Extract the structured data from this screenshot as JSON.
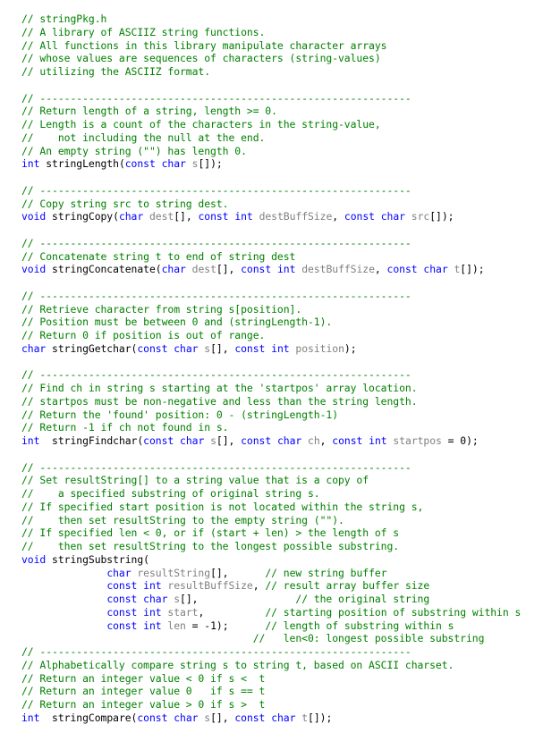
{
  "editor": {
    "file": "stringPkg.h",
    "colors": {
      "comment": "#008000",
      "keyword": "#0000ff",
      "parameter": "#808080",
      "identifier": "#000000",
      "background": "#ffffff"
    },
    "lines": [
      [
        [
          "cm",
          "// stringPkg.h"
        ]
      ],
      [
        [
          "cm",
          "// A library of ASCIIZ string functions."
        ]
      ],
      [
        [
          "cm",
          "// All functions in this library manipulate character arrays"
        ]
      ],
      [
        [
          "cm",
          "// whose values are sequences of characters (string-values)"
        ]
      ],
      [
        [
          "cm",
          "// utilizing the ASCIIZ format."
        ]
      ],
      [],
      [
        [
          "cm",
          "// -------------------------------------------------------------"
        ]
      ],
      [
        [
          "cm",
          "// Return length of a string, length >= 0."
        ]
      ],
      [
        [
          "cm",
          "// Length is a count of the characters in the string-value,"
        ]
      ],
      [
        [
          "cm",
          "//    not including the null at the end."
        ]
      ],
      [
        [
          "cm",
          "// An empty string (\"\") has length 0."
        ]
      ],
      [
        [
          "kw",
          "int"
        ],
        [
          "id",
          " stringLength("
        ],
        [
          "kw",
          "const"
        ],
        [
          "id",
          " "
        ],
        [
          "kw",
          "char"
        ],
        [
          "id",
          " "
        ],
        [
          "pm",
          "s"
        ],
        [
          "id",
          "[]);"
        ]
      ],
      [],
      [
        [
          "cm",
          "// -------------------------------------------------------------"
        ]
      ],
      [
        [
          "cm",
          "// Copy string src to string dest."
        ]
      ],
      [
        [
          "kw",
          "void"
        ],
        [
          "id",
          " stringCopy("
        ],
        [
          "kw",
          "char"
        ],
        [
          "id",
          " "
        ],
        [
          "pm",
          "dest"
        ],
        [
          "id",
          "[], "
        ],
        [
          "kw",
          "const"
        ],
        [
          "id",
          " "
        ],
        [
          "kw",
          "int"
        ],
        [
          "id",
          " "
        ],
        [
          "pm",
          "destBuffSize"
        ],
        [
          "id",
          ", "
        ],
        [
          "kw",
          "const"
        ],
        [
          "id",
          " "
        ],
        [
          "kw",
          "char"
        ],
        [
          "id",
          " "
        ],
        [
          "pm",
          "src"
        ],
        [
          "id",
          "[]);"
        ]
      ],
      [],
      [
        [
          "cm",
          "// -------------------------------------------------------------"
        ]
      ],
      [
        [
          "cm",
          "// Concatenate string t to end of string dest"
        ]
      ],
      [
        [
          "kw",
          "void"
        ],
        [
          "id",
          " stringConcatenate("
        ],
        [
          "kw",
          "char"
        ],
        [
          "id",
          " "
        ],
        [
          "pm",
          "dest"
        ],
        [
          "id",
          "[], "
        ],
        [
          "kw",
          "const"
        ],
        [
          "id",
          " "
        ],
        [
          "kw",
          "int"
        ],
        [
          "id",
          " "
        ],
        [
          "pm",
          "destBuffSize"
        ],
        [
          "id",
          ", "
        ],
        [
          "kw",
          "const"
        ],
        [
          "id",
          " "
        ],
        [
          "kw",
          "char"
        ],
        [
          "id",
          " "
        ],
        [
          "pm",
          "t"
        ],
        [
          "id",
          "[]);"
        ]
      ],
      [],
      [
        [
          "cm",
          "// -------------------------------------------------------------"
        ]
      ],
      [
        [
          "cm",
          "// Retrieve character from string s[position]."
        ]
      ],
      [
        [
          "cm",
          "// Position must be between 0 and (stringLength-1)."
        ]
      ],
      [
        [
          "cm",
          "// Return 0 if position is out of range."
        ]
      ],
      [
        [
          "kw",
          "char"
        ],
        [
          "id",
          " stringGetchar("
        ],
        [
          "kw",
          "const"
        ],
        [
          "id",
          " "
        ],
        [
          "kw",
          "char"
        ],
        [
          "id",
          " "
        ],
        [
          "pm",
          "s"
        ],
        [
          "id",
          "[], "
        ],
        [
          "kw",
          "const"
        ],
        [
          "id",
          " "
        ],
        [
          "kw",
          "int"
        ],
        [
          "id",
          " "
        ],
        [
          "pm",
          "position"
        ],
        [
          "id",
          ");"
        ]
      ],
      [],
      [
        [
          "cm",
          "// -------------------------------------------------------------"
        ]
      ],
      [
        [
          "cm",
          "// Find ch in string s starting at the 'startpos' array location."
        ]
      ],
      [
        [
          "cm",
          "// startpos must be non-negative and less than the string length."
        ]
      ],
      [
        [
          "cm",
          "// Return the 'found' position: 0 - (stringLength-1)"
        ]
      ],
      [
        [
          "cm",
          "// Return -1 if ch not found in s."
        ]
      ],
      [
        [
          "kw",
          "int"
        ],
        [
          "id",
          "  stringFindchar("
        ],
        [
          "kw",
          "const"
        ],
        [
          "id",
          " "
        ],
        [
          "kw",
          "char"
        ],
        [
          "id",
          " "
        ],
        [
          "pm",
          "s"
        ],
        [
          "id",
          "[], "
        ],
        [
          "kw",
          "const"
        ],
        [
          "id",
          " "
        ],
        [
          "kw",
          "char"
        ],
        [
          "id",
          " "
        ],
        [
          "pm",
          "ch"
        ],
        [
          "id",
          ", "
        ],
        [
          "kw",
          "const"
        ],
        [
          "id",
          " "
        ],
        [
          "kw",
          "int"
        ],
        [
          "id",
          " "
        ],
        [
          "pm",
          "startpos"
        ],
        [
          "id",
          " = 0);"
        ]
      ],
      [],
      [
        [
          "cm",
          "// -------------------------------------------------------------"
        ]
      ],
      [
        [
          "cm",
          "// Set resultString[] to a string value that is a copy of"
        ]
      ],
      [
        [
          "cm",
          "//    a specified substring of original string s."
        ]
      ],
      [
        [
          "cm",
          "// If specified start position is not located within the string s,"
        ]
      ],
      [
        [
          "cm",
          "//    then set resultString to the empty string (\"\")."
        ]
      ],
      [
        [
          "cm",
          "// If specified len < 0, or if (start + len) > the length of s"
        ]
      ],
      [
        [
          "cm",
          "//    then set resultString to the longest possible substring."
        ]
      ],
      [
        [
          "kw",
          "void"
        ],
        [
          "id",
          " stringSubstring("
        ]
      ],
      [
        [
          "id",
          "              "
        ],
        [
          "kw",
          "char"
        ],
        [
          "id",
          " "
        ],
        [
          "pm",
          "resultString"
        ],
        [
          "id",
          "[],      "
        ],
        [
          "cm",
          "// new string buffer"
        ]
      ],
      [
        [
          "id",
          "              "
        ],
        [
          "kw",
          "const"
        ],
        [
          "id",
          " "
        ],
        [
          "kw",
          "int"
        ],
        [
          "id",
          " "
        ],
        [
          "pm",
          "resultBuffSize"
        ],
        [
          "id",
          ", "
        ],
        [
          "cm",
          "// result array buffer size"
        ]
      ],
      [
        [
          "id",
          "              "
        ],
        [
          "kw",
          "const"
        ],
        [
          "id",
          " "
        ],
        [
          "kw",
          "char"
        ],
        [
          "id",
          " "
        ],
        [
          "pm",
          "s"
        ],
        [
          "id",
          "[],                "
        ],
        [
          "cm",
          "// the original string"
        ]
      ],
      [
        [
          "id",
          "              "
        ],
        [
          "kw",
          "const"
        ],
        [
          "id",
          " "
        ],
        [
          "kw",
          "int"
        ],
        [
          "id",
          " "
        ],
        [
          "pm",
          "start"
        ],
        [
          "id",
          ",          "
        ],
        [
          "cm",
          "// starting position of substring within s"
        ]
      ],
      [
        [
          "id",
          "              "
        ],
        [
          "kw",
          "const"
        ],
        [
          "id",
          " "
        ],
        [
          "kw",
          "int"
        ],
        [
          "id",
          " "
        ],
        [
          "pm",
          "len"
        ],
        [
          "id",
          " = -1);      "
        ],
        [
          "cm",
          "// length of substring within s"
        ]
      ],
      [
        [
          "id",
          "                                      "
        ],
        [
          "cm",
          "//   len<0: longest possible substring"
        ]
      ],
      [
        [
          "cm",
          "// -------------------------------------------------------------"
        ]
      ],
      [
        [
          "cm",
          "// Alphabetically compare string s to string t, based on ASCII charset."
        ]
      ],
      [
        [
          "cm",
          "// Return an integer value < 0 if s <  t"
        ]
      ],
      [
        [
          "cm",
          "// Return an integer value 0   if s == t"
        ]
      ],
      [
        [
          "cm",
          "// Return an integer value > 0 if s >  t"
        ]
      ],
      [
        [
          "kw",
          "int"
        ],
        [
          "id",
          "  stringCompare("
        ],
        [
          "kw",
          "const"
        ],
        [
          "id",
          " "
        ],
        [
          "kw",
          "char"
        ],
        [
          "id",
          " "
        ],
        [
          "pm",
          "s"
        ],
        [
          "id",
          "[], "
        ],
        [
          "kw",
          "const"
        ],
        [
          "id",
          " "
        ],
        [
          "kw",
          "char"
        ],
        [
          "id",
          " "
        ],
        [
          "pm",
          "t"
        ],
        [
          "id",
          "[]);"
        ]
      ]
    ]
  }
}
